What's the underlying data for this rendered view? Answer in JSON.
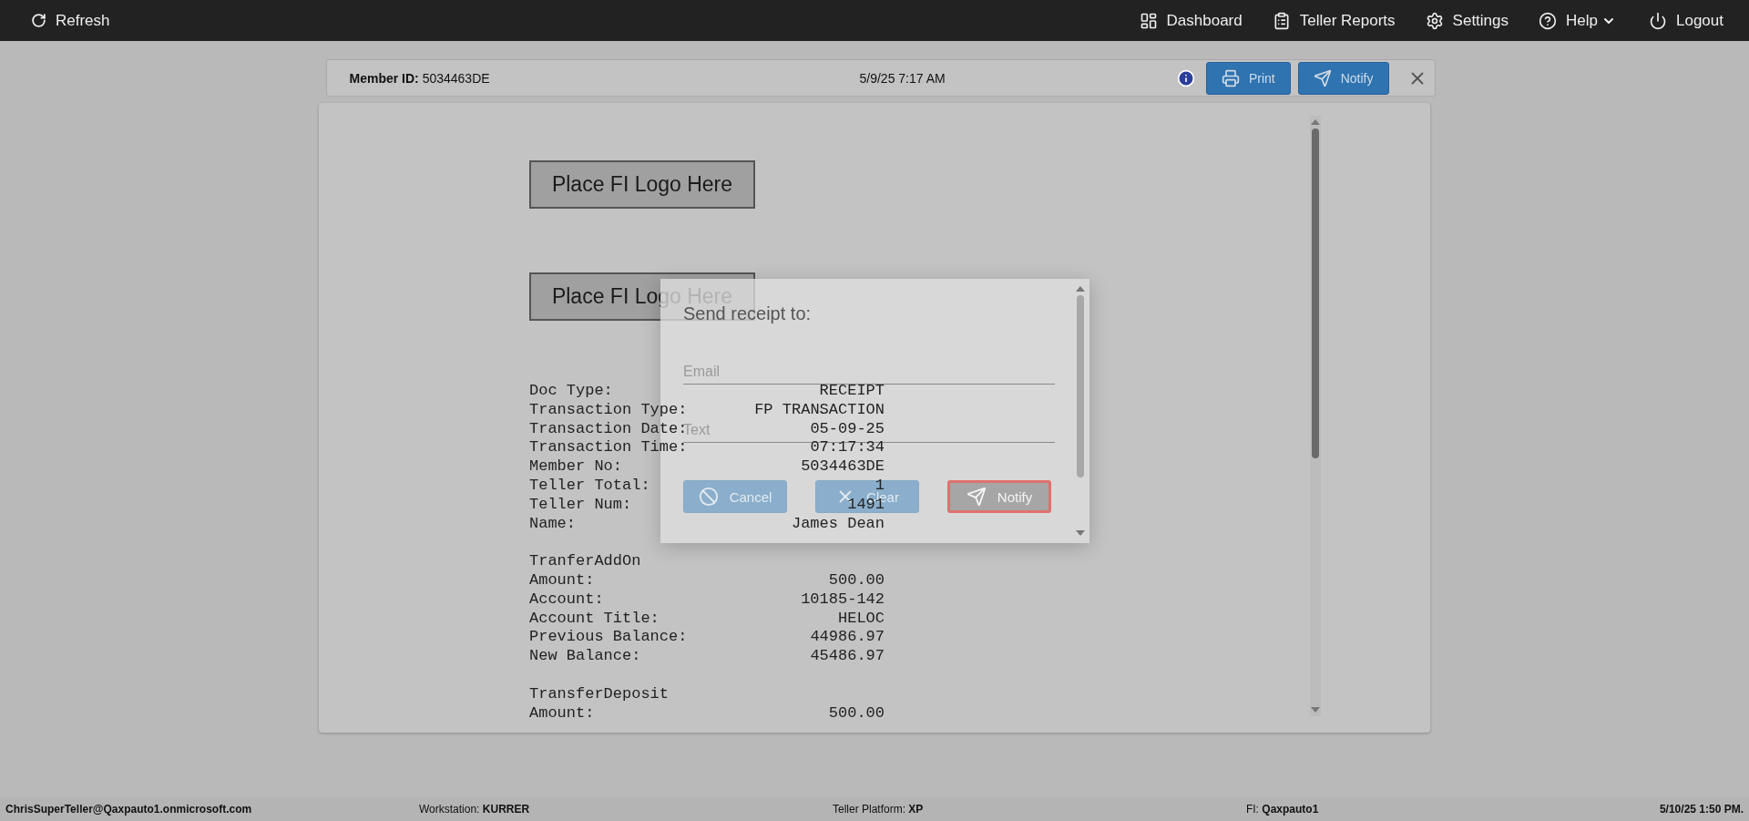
{
  "top_bar": {
    "refresh": "Refresh",
    "nav": [
      {
        "kind": "dashboard",
        "label": "Dashboard"
      },
      {
        "kind": "reports",
        "label": "Teller Reports"
      },
      {
        "kind": "settings",
        "label": "Settings"
      },
      {
        "kind": "help",
        "label": "Help"
      },
      {
        "kind": "logout",
        "label": "Logout"
      }
    ]
  },
  "header": {
    "member_label": "Member ID:",
    "member_id": "5034463DE",
    "datetime": "5/9/25 7:17 AM",
    "buttons": [
      {
        "kind": "print",
        "label": "Print"
      },
      {
        "kind": "notify",
        "label": "Notify"
      }
    ]
  },
  "receipt": {
    "logos": [
      "Place FI Logo Here",
      "Place FI Logo Here"
    ],
    "sections": [
      {
        "rows": [
          {
            "label": "Doc Type:",
            "value": "RECEIPT"
          },
          {
            "label": "Transaction Type:",
            "value": "FP TRANSACTION"
          },
          {
            "label": "Transaction Date:",
            "value": "05-09-25"
          },
          {
            "label": "Transaction Time:",
            "value": "07:17:34"
          },
          {
            "label": "Member No:",
            "value": "5034463DE"
          },
          {
            "label": "Teller Total:",
            "value": "1"
          },
          {
            "label": "Teller Num:",
            "value": "1491"
          },
          {
            "label": "Name:",
            "value": "James Dean"
          }
        ]
      },
      {
        "title": "TranferAddOn",
        "rows": [
          {
            "label": "Amount:",
            "value": "500.00"
          },
          {
            "label": "Account:",
            "value": "10185-142"
          },
          {
            "label": "Account Title:",
            "value": "HELOC"
          },
          {
            "label": "Previous Balance:",
            "value": "44986.97"
          },
          {
            "label": "New Balance:",
            "value": "45486.97"
          }
        ]
      },
      {
        "title": "TransferDeposit",
        "rows": [
          {
            "label": "Amount:",
            "value": "500.00"
          }
        ]
      }
    ]
  },
  "dialog": {
    "title": "Send receipt to:",
    "fields": [
      {
        "placeholder": "Email"
      },
      {
        "placeholder": "Text"
      }
    ],
    "buttons": [
      {
        "kind": "cancel",
        "label": "Cancel",
        "disabled": false,
        "focused": false
      },
      {
        "kind": "clear",
        "label": "Clear",
        "disabled": false,
        "focused": false
      },
      {
        "kind": "notify",
        "label": "Notify",
        "disabled": true,
        "focused": true
      }
    ]
  },
  "status_bar": [
    {
      "value": "ChrisSuperTeller@Qaxpauto1.onmicrosoft.com"
    },
    {
      "label": "Workstation:",
      "value": "KURRER"
    },
    {
      "label": "Teller Platform:",
      "value": "XP"
    },
    {
      "label": "FI:",
      "value": "Qaxpauto1"
    },
    {
      "value": "5/10/25 1:50 PM."
    }
  ]
}
